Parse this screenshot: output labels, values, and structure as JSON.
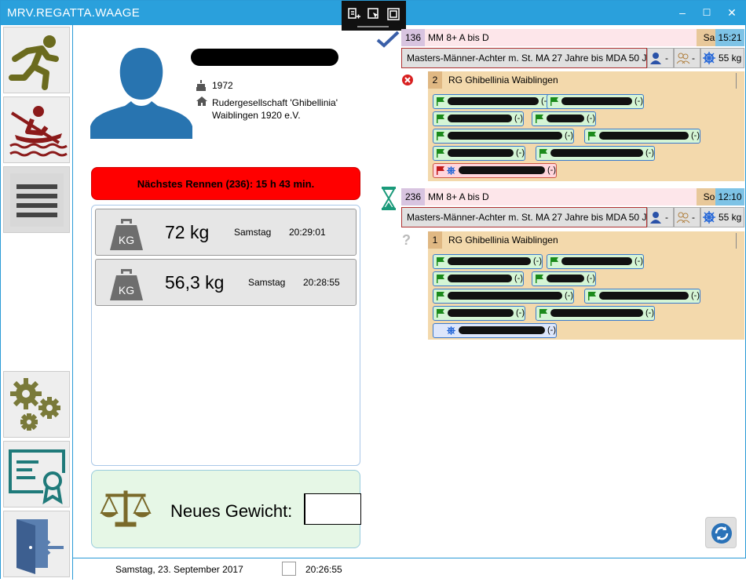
{
  "window": {
    "title": "MRV.REGATTA.WAAGE",
    "minimize": "‒",
    "maximize": "☐",
    "close": "✕"
  },
  "athlete": {
    "birth_year": "1972",
    "club": "Rudergesellschaft 'Ghibellinia' Waiblingen 1920 e.V."
  },
  "next_race": "Nächstes Rennen (236): 15 h 43 min.",
  "weighings": [
    {
      "value": "72  kg",
      "day": "Samstag",
      "time": "20:29:01"
    },
    {
      "value": "56,3  kg",
      "day": "Samstag",
      "time": "20:28:55"
    }
  ],
  "new_weight": {
    "label": "Neues Gewicht:",
    "value": ""
  },
  "status": {
    "date": "Samstag, 23. September 2017",
    "time": "20:26:55"
  },
  "races": [
    {
      "status": "done",
      "number": "136",
      "name": "MM 8+ A bis D",
      "day": "Sa",
      "time": "15:21",
      "description": "Masters-Männer-Achter m. St.  MA 27 Jahre bis MDA 50 J",
      "rowers_label": "-",
      "cox_label": "-",
      "weight_label": "55 kg",
      "crew": {
        "mark": "✖",
        "lane": "2",
        "club": "RG Ghibellinia Waiblingen"
      },
      "participants": [
        {
          "suffix": "(-)",
          "color": "green"
        },
        {
          "suffix": "(-)",
          "color": "green"
        },
        {
          "suffix": "(-)",
          "color": "green"
        },
        {
          "suffix": "(-)",
          "color": "green"
        },
        {
          "suffix": "(-)",
          "color": "green"
        },
        {
          "suffix": "(-)",
          "color": "green"
        },
        {
          "suffix": "(-)",
          "color": "green"
        },
        {
          "suffix": "(-)",
          "color": "green"
        },
        {
          "suffix": "(-)",
          "color": "red"
        }
      ]
    },
    {
      "status": "pending",
      "number": "236",
      "name": "MM 8+ A bis D",
      "day": "So",
      "time": "12:10",
      "description": "Masters-Männer-Achter m. St.  MA 27 Jahre bis MDA 50 J",
      "rowers_label": "-",
      "cox_label": "-",
      "weight_label": "55 kg",
      "crew": {
        "mark": "?",
        "lane": "1",
        "club": "RG Ghibellinia Waiblingen"
      },
      "participants": [
        {
          "suffix": "(-)",
          "color": "green"
        },
        {
          "suffix": "(-)",
          "color": "green"
        },
        {
          "suffix": "(-)",
          "color": "green"
        },
        {
          "suffix": "(-)",
          "color": "green"
        },
        {
          "suffix": "(-)",
          "color": "green"
        },
        {
          "suffix": "(-)",
          "color": "green"
        },
        {
          "suffix": "(-)",
          "color": "green"
        },
        {
          "suffix": "(-)",
          "color": "green"
        },
        {
          "suffix": "(-)",
          "color": "blue"
        }
      ]
    }
  ],
  "nav": [
    "athletics-icon",
    "rowing-icon",
    "menu-icon",
    "settings-icon",
    "certificate-icon",
    "exit-icon"
  ],
  "colors": {
    "titlebar": "#2aa0dc",
    "next_race_bg": "#ff0000",
    "accent": "#2a9ad6"
  }
}
